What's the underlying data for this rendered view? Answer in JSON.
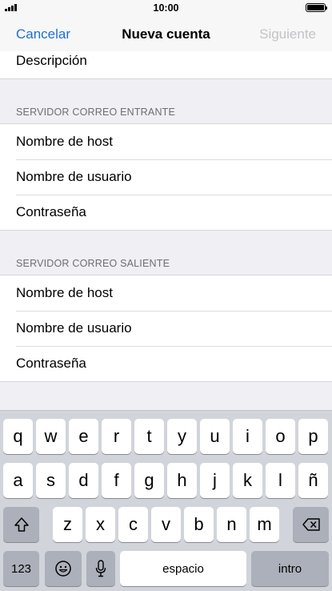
{
  "status_bar": {
    "time": "10:00",
    "signal_icon": "signal-bars-icon",
    "battery_icon": "battery-full-icon"
  },
  "nav": {
    "cancel": "Cancelar",
    "title": "Nueva cuenta",
    "next": "Siguiente",
    "accent_color": "#1f6fd1",
    "disabled_color": "#c3c3c8"
  },
  "form": {
    "top_field": "Descripción",
    "incoming": {
      "header": "SERVIDOR CORREO ENTRANTE",
      "host": "Nombre de host",
      "username": "Nombre de usuario",
      "password": "Contraseña"
    },
    "outgoing": {
      "header": "SERVIDOR CORREO SALIENTE",
      "host": "Nombre de host",
      "username": "Nombre de usuario",
      "password": "Contraseña"
    }
  },
  "keyboard": {
    "row1": [
      "q",
      "w",
      "e",
      "r",
      "t",
      "y",
      "u",
      "i",
      "o",
      "p"
    ],
    "row2": [
      "a",
      "s",
      "d",
      "f",
      "g",
      "h",
      "j",
      "k",
      "l",
      "ñ"
    ],
    "row3": [
      "z",
      "x",
      "c",
      "v",
      "b",
      "n",
      "m"
    ],
    "numbers_key": "123",
    "space_key": "espacio",
    "return_key": "intro",
    "shift_icon": "shift-icon",
    "delete_icon": "delete-icon",
    "emoji_icon": "emoji-icon",
    "mic_icon": "microphone-icon"
  }
}
